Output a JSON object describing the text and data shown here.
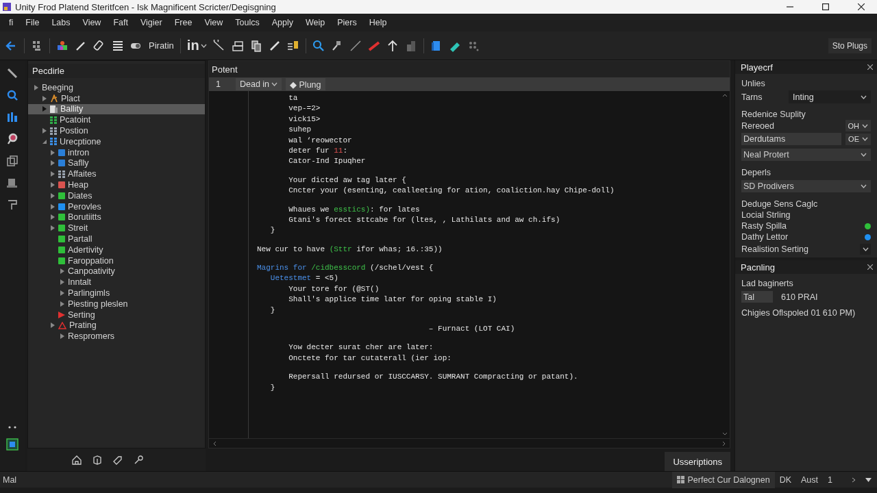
{
  "window": {
    "title": "Unity Frod Platend Steritfcen - Isk Magnificent Scricter/Degisgning"
  },
  "menu": [
    "fi",
    "File",
    "Labs",
    "View",
    "Faft",
    "Vigier",
    "Free",
    "View",
    "Toulcs",
    "Apply",
    "Weip",
    "Piers",
    "Help"
  ],
  "toolbar": {
    "text_button": "Piratin",
    "dropdown": "in",
    "right_button": "Sto Plugs"
  },
  "sidebar": {
    "title": "Pecdirle",
    "tree": [
      {
        "label": "Beeging",
        "expanded": false,
        "selected": false,
        "children": [
          {
            "label": "Plact",
            "expanded": false,
            "kind": "spark",
            "selected": false
          },
          {
            "label": "Ballity",
            "expanded": false,
            "kind": "page",
            "selected": true
          },
          {
            "label": "Pcatoint",
            "kind": "grid",
            "color": "#2fae4a",
            "selected": false
          },
          {
            "label": "Postion",
            "expanded": false,
            "kind": "grid",
            "color": "#9aa4b0",
            "selected": false
          },
          {
            "label": "Urecptione",
            "expanded": true,
            "kind": "grid",
            "color": "#3a8ee6",
            "selected": false,
            "children": [
              {
                "label": "intron",
                "expanded": false,
                "kind": "square",
                "color": "#2a7fd8",
                "selected": false
              },
              {
                "label": "Saflly",
                "expanded": false,
                "kind": "square",
                "color": "#2a7fd8",
                "selected": false
              },
              {
                "label": "Affaites",
                "expanded": false,
                "kind": "grid",
                "color": "#9aa4b0",
                "selected": false
              },
              {
                "label": "Heap",
                "expanded": false,
                "kind": "square",
                "color": "#d9534f",
                "selected": false
              },
              {
                "label": "Diates",
                "expanded": false,
                "kind": "square",
                "color": "#2fbf3a",
                "selected": false
              },
              {
                "label": "Perovles",
                "expanded": false,
                "kind": "square",
                "color": "#1f8ff0",
                "selected": false
              },
              {
                "label": "Borutiitts",
                "expanded": false,
                "kind": "square",
                "color": "#2fbf3a",
                "selected": false
              },
              {
                "label": "Streit",
                "expanded": false,
                "kind": "square",
                "color": "#2fbf3a",
                "selected": false
              },
              {
                "label": "Partall",
                "kind": "square",
                "color": "#2fbf3a",
                "selected": false
              },
              {
                "label": "Adertivity",
                "kind": "square",
                "color": "#2fbf3a",
                "selected": false
              },
              {
                "label": "Faroppation",
                "kind": "square",
                "color": "#2fbf3a",
                "selected": false
              },
              {
                "label": "Canpoativity",
                "expanded": false,
                "kind": "none",
                "selected": false
              },
              {
                "label": "Inntalt",
                "expanded": false,
                "kind": "none",
                "selected": false
              },
              {
                "label": "Parlingimls",
                "expanded": false,
                "kind": "none",
                "selected": false
              },
              {
                "label": "Piesting pleslen",
                "expanded": false,
                "kind": "none",
                "selected": false
              },
              {
                "label": "Serting",
                "kind": "flag",
                "selected": false
              },
              {
                "label": "Prating",
                "expanded": false,
                "kind": "warning",
                "selected": false
              },
              {
                "label": "Respromers",
                "expanded": false,
                "kind": "none",
                "selected": false
              }
            ]
          }
        ]
      }
    ]
  },
  "editor": {
    "title": "Potent",
    "tabs": [
      {
        "label": "1",
        "kind": "number"
      },
      {
        "label": "Dead in",
        "kind": "dropdown"
      },
      {
        "label": "◆ Plung",
        "kind": "button"
      }
    ],
    "lines": [
      {
        "segments": [
          {
            "text": "       ta",
            "kind": "plain"
          }
        ]
      },
      {
        "segments": [
          {
            "text": "       vep-=2>",
            "kind": "plain"
          }
        ]
      },
      {
        "segments": [
          {
            "text": "       vick15>",
            "kind": "plain"
          }
        ]
      },
      {
        "segments": [
          {
            "text": "       suhep",
            "kind": "plain"
          }
        ]
      },
      {
        "segments": [
          {
            "text": "       wal ‘reowector",
            "kind": "plain"
          }
        ]
      },
      {
        "segments": [
          {
            "text": "       deter fur ",
            "kind": "plain"
          },
          {
            "text": "11",
            "kind": "number"
          },
          {
            "text": ":",
            "kind": "plain"
          }
        ]
      },
      {
        "segments": [
          {
            "text": "       Cator-Ind Ipuqher",
            "kind": "plain"
          }
        ]
      },
      {
        "kind": "blank"
      },
      {
        "segments": [
          {
            "text": "       Your dicted aw tag later {",
            "kind": "plain"
          }
        ]
      },
      {
        "segments": [
          {
            "text": "       Cncter your (esenting, cealleeting for ation, coaliction.hay Chipe-doll)",
            "kind": "plain"
          }
        ]
      },
      {
        "kind": "blank"
      },
      {
        "segments": [
          {
            "text": "       Whaues we ",
            "kind": "plain"
          },
          {
            "text": "esstics)",
            "kind": "string"
          },
          {
            "text": ": for lates",
            "kind": "plain"
          }
        ]
      },
      {
        "segments": [
          {
            "text": "       Gtani's forect sttcabe for (ltes, , Lathilats and aw ch.ifs)",
            "kind": "plain"
          }
        ]
      },
      {
        "segments": [
          {
            "text": "   }",
            "kind": "plain"
          }
        ]
      },
      {
        "kind": "blank"
      },
      {
        "segments": [
          {
            "text": "New cur to have ",
            "kind": "plain"
          },
          {
            "text": "(Sttr",
            "kind": "string"
          },
          {
            "text": " ifor whas; 16.:35))",
            "kind": "plain"
          }
        ]
      },
      {
        "kind": "blank"
      },
      {
        "segments": [
          {
            "text": "Magrins for ",
            "kind": "keyword"
          },
          {
            "text": "/cidbesscord",
            "kind": "string"
          },
          {
            "text": " (/schel/vest {",
            "kind": "plain"
          }
        ]
      },
      {
        "segments": [
          {
            "text": "   Uetestmet",
            "kind": "keyword"
          },
          {
            "text": " = <5)",
            "kind": "plain"
          }
        ]
      },
      {
        "segments": [
          {
            "text": "       Your tore for (@ST()",
            "kind": "plain"
          }
        ]
      },
      {
        "segments": [
          {
            "text": "       Shall's applice time later for oping stable I)",
            "kind": "plain"
          }
        ]
      },
      {
        "segments": [
          {
            "text": "   }",
            "kind": "plain"
          }
        ]
      },
      {
        "kind": "blank"
      },
      {
        "segments": [
          {
            "text": "                                      – Furnact (LOT CAI)",
            "kind": "plain"
          }
        ]
      },
      {
        "kind": "blank"
      },
      {
        "segments": [
          {
            "text": "       Yow decter surat cher are later:",
            "kind": "plain"
          }
        ]
      },
      {
        "segments": [
          {
            "text": "       Onctete for tar cutaterall (ier iop:",
            "kind": "plain"
          }
        ]
      },
      {
        "kind": "blank"
      },
      {
        "segments": [
          {
            "text": "       Repersall redursed or IUSCCARSY. SUMRANT Compracting or patant).",
            "kind": "plain"
          }
        ]
      },
      {
        "segments": [
          {
            "text": "   }",
            "kind": "plain"
          }
        ]
      }
    ],
    "footer_button": "Usseriptions"
  },
  "inspector": {
    "title": "Playecrf",
    "rows": [
      {
        "kind": "label",
        "text": "Unlies"
      },
      {
        "kind": "select-row",
        "label": "Tarns",
        "value": "Inting"
      },
      {
        "kind": "label",
        "text": "Redenice Suplity"
      },
      {
        "kind": "toggle-row",
        "label": "Rereoed",
        "value": "OH"
      },
      {
        "kind": "field-toggle",
        "label": "Derdutams",
        "value": "OE"
      },
      {
        "kind": "select",
        "value": "Neal Protert"
      },
      {
        "kind": "label",
        "text": "Deperls"
      },
      {
        "kind": "select",
        "value": "SD Prodivers"
      },
      {
        "kind": "label",
        "text": "Deduge Sens Caglc"
      },
      {
        "kind": "label",
        "text": "Locial Strling"
      },
      {
        "kind": "dot",
        "text": "Rasty Spilla",
        "color": "#2fbf3a"
      },
      {
        "kind": "dot",
        "text": "Dathy Lettor",
        "color": "#1f8ff0"
      },
      {
        "kind": "expander",
        "text": "Realistion Serting"
      }
    ]
  },
  "panel2": {
    "title": "Pacnling",
    "heading": "Lad baginerts",
    "field": "Tal",
    "value": "610 PRAI",
    "note": "Chigies Oflspoled 01 610 PM)"
  },
  "status_bar": {
    "left": "Mal",
    "items": [
      "Perfect Cur Dalognen",
      "DK",
      "Aust",
      "1"
    ]
  }
}
